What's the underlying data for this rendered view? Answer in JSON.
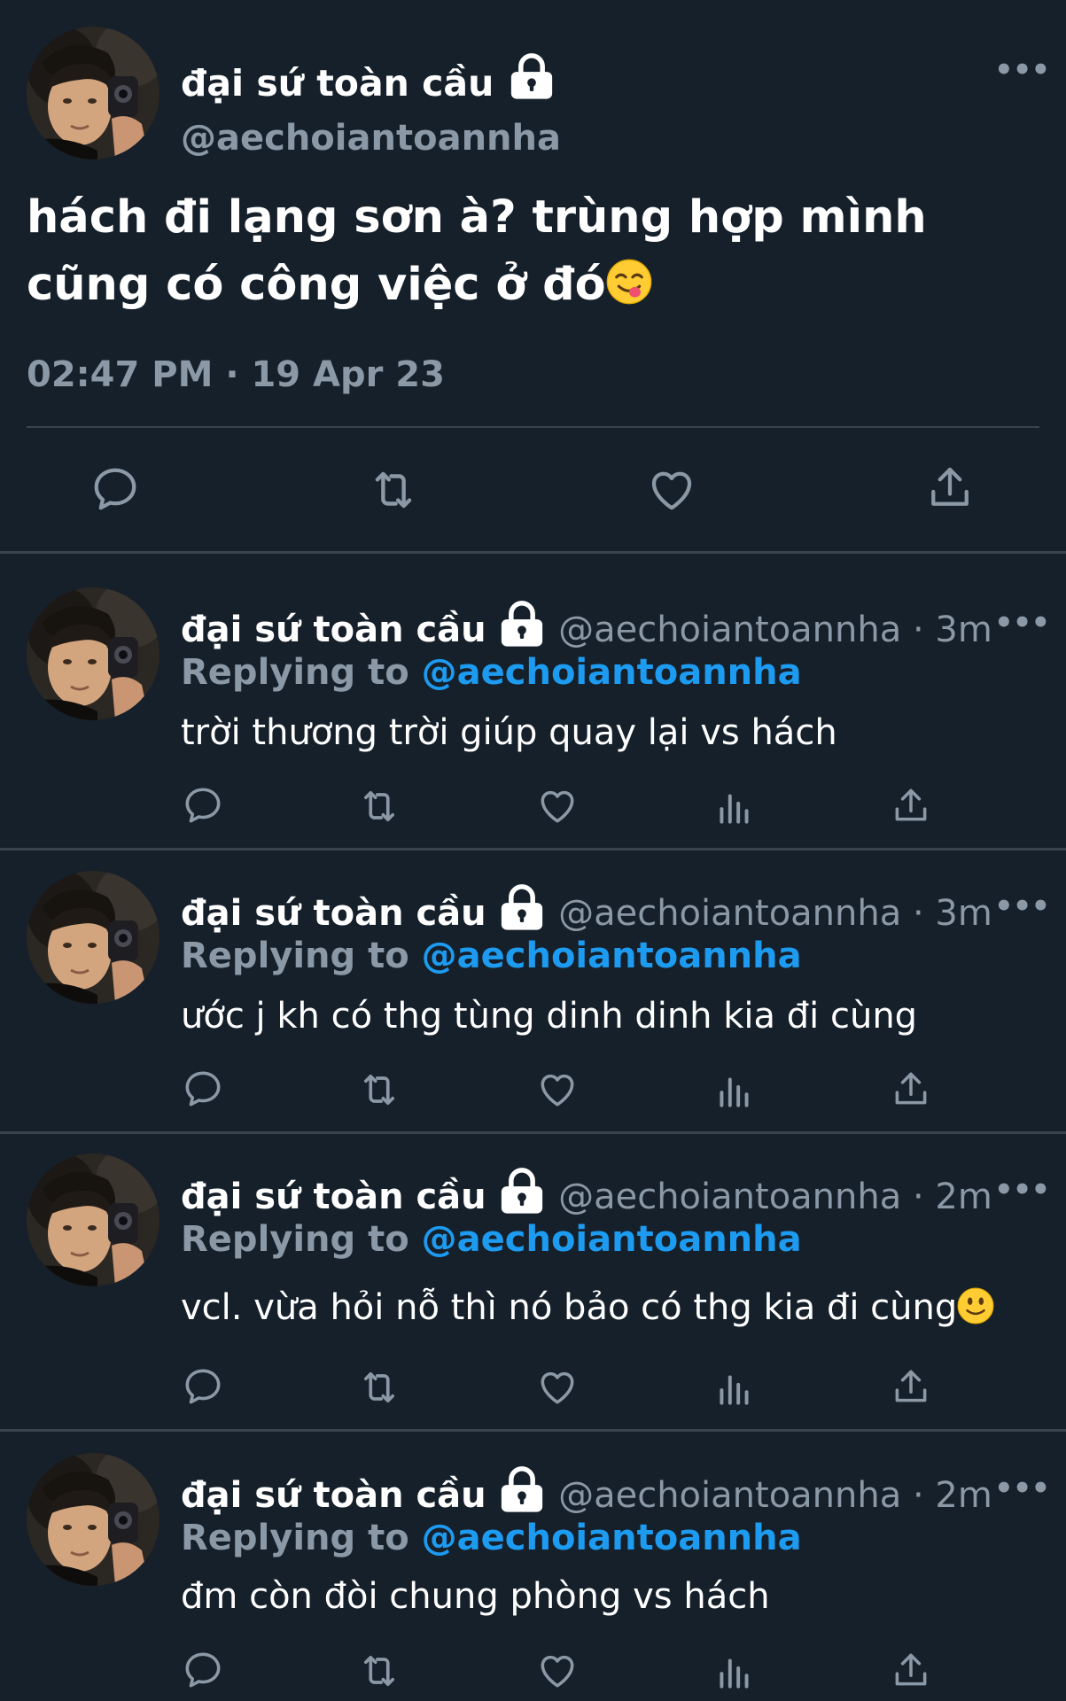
{
  "main_tweet": {
    "display_name": "đại sứ toàn cầu",
    "handle": "@aechoiantoannha",
    "text": "hách đi lạng sơn à? trùng hợp mình cũng có công việc ở đó",
    "emoji": "yum-face-emoji",
    "time": "02:47 PM",
    "date": "19 Apr 23",
    "more_icon": "more-dots-icon",
    "actions": [
      "reply-icon",
      "retweet-icon",
      "like-icon",
      "share-icon"
    ]
  },
  "replies": [
    {
      "display_name": "đại sứ toàn cầu",
      "handle": "@aechoiantoannha",
      "age": "3m",
      "replying_label": "Replying to",
      "replying_to": "@aechoiantoannha",
      "text": "trời thương trời giúp quay lại vs hách"
    },
    {
      "display_name": "đại sứ toàn cầu",
      "handle": "@aechoiantoannha",
      "age": "3m",
      "replying_label": "Replying to",
      "replying_to": "@aechoiantoannha",
      "text": "ước j kh có thg tùng dinh dinh kia đi cùng"
    },
    {
      "display_name": "đại sứ toàn cầu",
      "handle": "@aechoiantoannha",
      "age": "2m",
      "replying_label": "Replying to",
      "replying_to": "@aechoiantoannha",
      "text": "vcl. vừa hỏi nỗ thì nó bảo có thg kia đi cùng",
      "emoji": "slightly-smiling-face-emoji"
    },
    {
      "display_name": "đại sứ toàn cầu",
      "handle": "@aechoiantoannha",
      "age": "2m",
      "replying_label": "Replying to",
      "replying_to": "@aechoiantoannha",
      "text": "đm còn đòi chung phòng vs hách"
    }
  ],
  "separator": "·",
  "reply_actions": [
    "reply-icon",
    "retweet-icon",
    "like-icon",
    "analytics-icon",
    "share-icon"
  ],
  "colors": {
    "background": "#15202b",
    "text": "#ffffff",
    "secondary": "#8b98a5",
    "link": "#1d9bf0",
    "divider": "#38444d"
  }
}
